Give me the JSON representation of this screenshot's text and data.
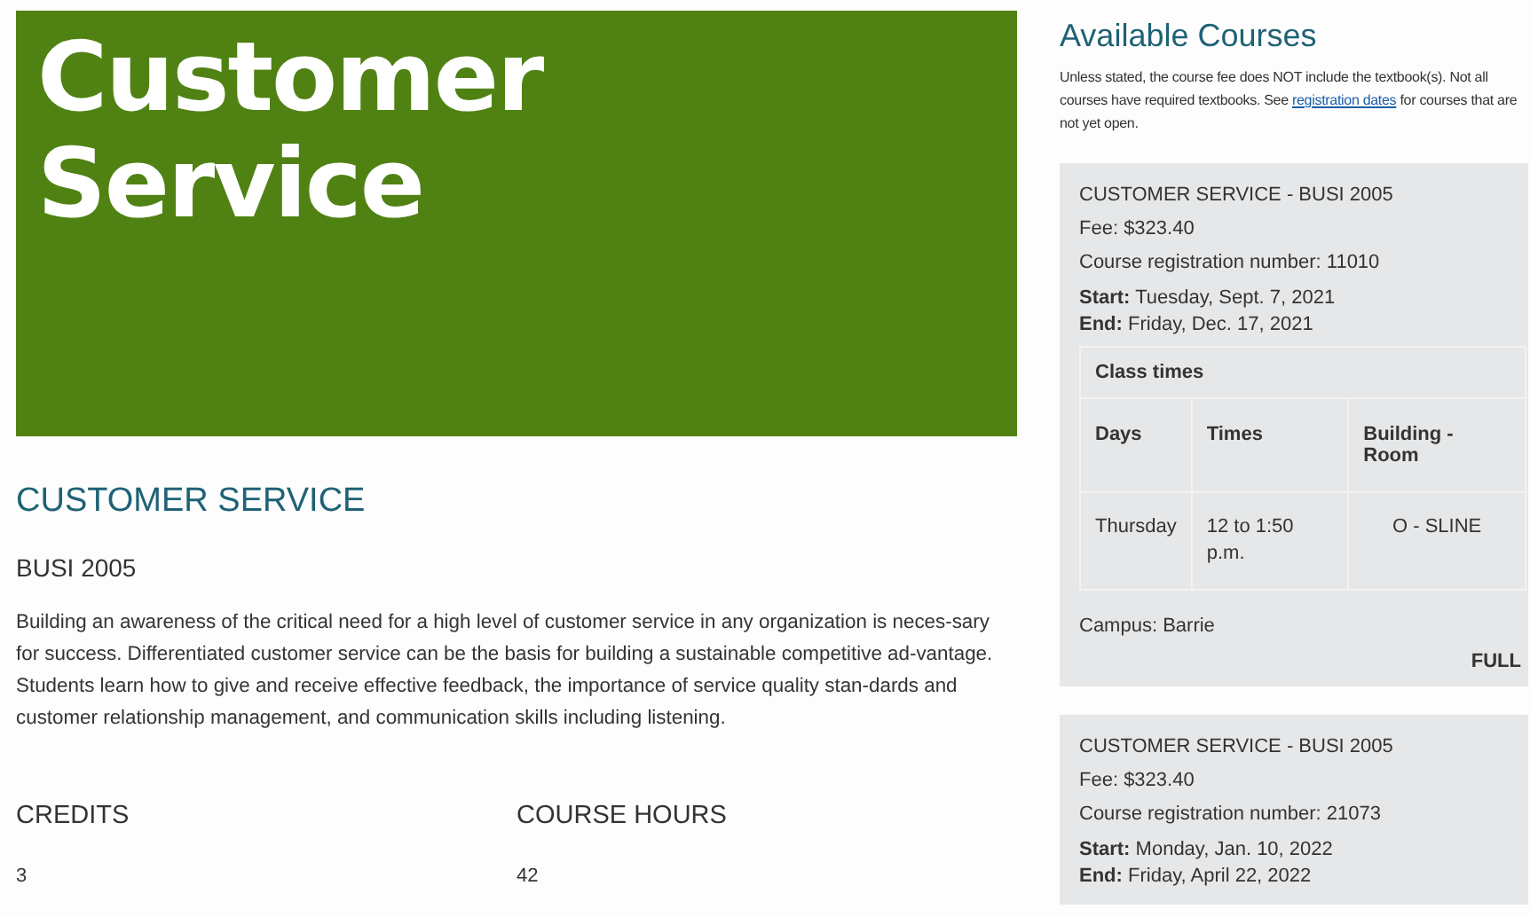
{
  "banner": {
    "title": "Customer Service"
  },
  "course": {
    "title": "CUSTOMER SERVICE",
    "code": "BUSI 2005",
    "description": "Building an awareness of the critical need for a high level of customer service in any organization is neces-sary for success. Differentiated customer service can be the basis for building a sustainable competitive ad-vantage. Students learn how to give and receive effective feedback, the importance of service quality stan-dards and customer relationship management, and communication skills including listening.",
    "facts": [
      {
        "label": "CREDITS",
        "value": "3"
      },
      {
        "label": "COURSE HOURS",
        "value": "42"
      }
    ]
  },
  "available": {
    "title": "Available Courses",
    "note_before": "Unless stated, the course fee does NOT include the textbook(s). Not all courses have required textbooks. See",
    "link": "registration dates",
    "note_after": "for courses that are not yet open.",
    "sections": [
      {
        "name": "CUSTOMER SERVICE - BUSI 2005",
        "fee": "Fee: $323.40",
        "crn": "Course registration number: 11010",
        "start": "**Start:** Tuesday, Sept. 7, 2021",
        "end": "**End:** Friday, Dec. 17, 2021",
        "class_times": {
          "title": "Class times",
          "columns": [
            "Days",
            "Times",
            "Building - Room"
          ],
          "rows": [
            [
              "Thursday",
              "12 to 1:50 p.m.",
              "O - SLINE"
            ]
          ]
        },
        "campus": "Campus: Barrie",
        "status": "FULL"
      },
      {
        "name": "CUSTOMER SERVICE - BUSI 2005",
        "fee": "Fee: $323.40",
        "crn": "Course registration number: 21073",
        "start": "**Start:** Monday, Jan. 10, 2022",
        "end": "**End:** Friday, April 22, 2022"
      }
    ]
  }
}
